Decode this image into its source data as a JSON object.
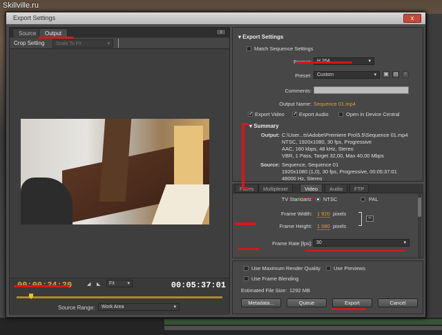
{
  "site_label": "Skillville.ru",
  "dialog": {
    "title": "Export Settings",
    "close_label": "x"
  },
  "left_panel": {
    "tabs": [
      "Source",
      "Output"
    ],
    "active_tab": "Output",
    "crop_setting_label": "Crop Setting",
    "crop_select_value": "Scale To Fit",
    "current_timecode": "00:00:24:20",
    "fit_value": "Fit",
    "duration_timecode": "00:05:37:01",
    "source_range_label": "Source Range:",
    "source_range_value": "Work Area"
  },
  "export_settings": {
    "title": "Export Settings",
    "match_sequence_label": "Match Sequence Settings",
    "format_label": "Format:",
    "format_value": "H.264",
    "preset_label": "Preset:",
    "preset_value": "Custom",
    "comments_label": "Comments:",
    "output_name_label": "Output Name:",
    "output_name_value": "Sequence 01.mp4",
    "export_video_label": "Export Video",
    "export_audio_label": "Export Audio",
    "open_device_label": "Open in Device Central",
    "summary_title": "Summary",
    "output_label": "Output:",
    "output_lines": [
      "C:\\User...ts\\Adobe\\Premiere Pro\\5.5\\Sequence 01.mp4",
      "NTSC, 1920x1080, 30 fps, Progressive",
      "AAC, 160 kbps, 48 kHz, Stereo",
      "VBR, 1 Pass, Target 32,00, Max 40,00 Mbps"
    ],
    "source_label": "Source:",
    "source_lines": [
      "Sequence, Sequence 01",
      "1920x1080 (1,0), 30 fps, Progressive, 00:05:37:01",
      "48000 Hz, Stereo"
    ]
  },
  "settings_tabs": [
    "Filters",
    "Multiplexer",
    "Video",
    "Audio",
    "FTP"
  ],
  "active_settings_tab": "Video",
  "video_settings": {
    "tv_standard_label": "TV Standard:",
    "ntsc_label": "NTSC",
    "pal_label": "PAL",
    "frame_width_label": "Frame Width:",
    "frame_width_value": "1 920",
    "frame_height_label": "Frame Height:",
    "frame_height_value": "1 080",
    "pixels_label": "pixels",
    "frame_rate_label": "Frame Rate [fps]:",
    "frame_rate_value": "30"
  },
  "bottom": {
    "max_render_label": "Use Maximum Render Quality",
    "use_previews_label": "Use Previews",
    "frame_blending_label": "Use Frame Blending",
    "estimated_size_label": "Estimated File Size:",
    "estimated_size_value": "1292 MB",
    "metadata_button": "Metadata...",
    "queue_button": "Queue",
    "export_button": "Export",
    "cancel_button": "Cancel"
  },
  "colors": {
    "accent_orange": "#e0a030",
    "annotation_red": "#d5181a",
    "timecode": "#e8a52a"
  }
}
